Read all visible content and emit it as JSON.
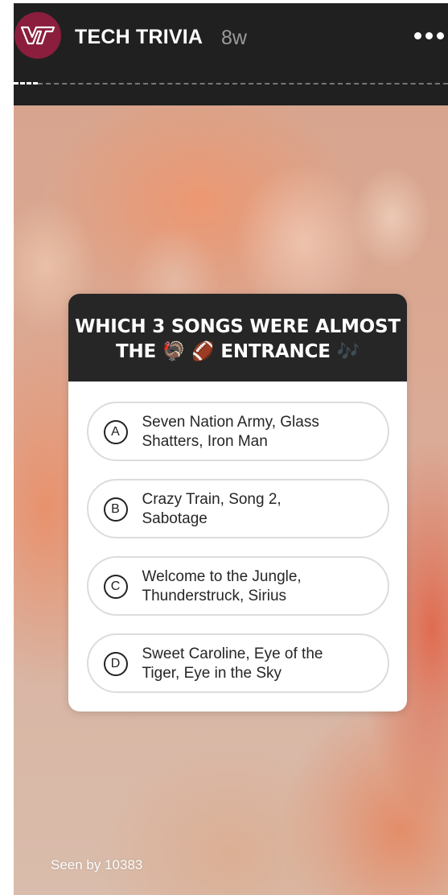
{
  "header": {
    "account_name": "TECH TRIVIA",
    "post_age": "8w",
    "avatar_icon": "vt-logo-icon",
    "menu_icon": "more-horizontal-icon"
  },
  "poll": {
    "question_line1": "WHICH 3 SONGS WERE ALMOST",
    "question_line2_prefix": "THE",
    "question_emoji_1": "🦃",
    "question_emoji_2": "🏈",
    "question_line2_word": "ENTRANCE",
    "question_emoji_3": "🎶",
    "options": [
      {
        "letter": "A",
        "line1": "Seven Nation Army, Glass",
        "line2": "Shatters, Iron Man"
      },
      {
        "letter": "B",
        "line1": "Crazy Train, Song 2,",
        "line2": "Sabotage"
      },
      {
        "letter": "C",
        "line1": "Welcome to the Jungle,",
        "line2": "Thunderstruck, Sirius"
      },
      {
        "letter": "D",
        "line1": "Sweet Caroline, Eye of the",
        "line2": "Tiger, Eye in the Sky"
      }
    ]
  },
  "footer": {
    "seen_by": "Seen by 10383"
  },
  "colors": {
    "brand": "#8a1e3c",
    "header_bg": "#202020",
    "question_bg": "#262626"
  }
}
